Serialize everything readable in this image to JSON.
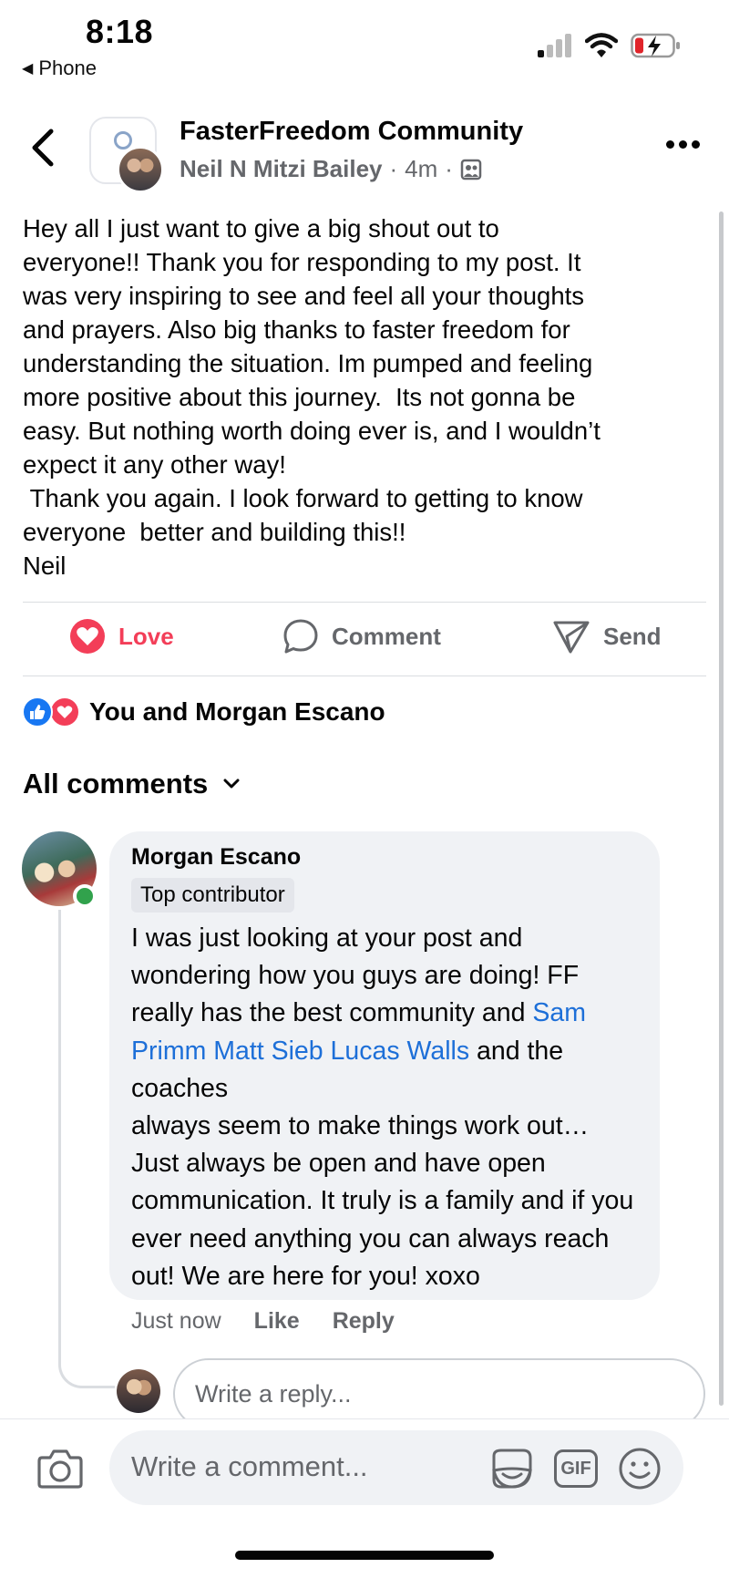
{
  "status_bar": {
    "time": "8:18",
    "back_app": "Phone",
    "icons": [
      "signal-icon",
      "wifi-icon",
      "battery-charging-icon"
    ]
  },
  "header": {
    "group_name": "FasterFreedom Community",
    "author": "Neil N Mitzi Bailey",
    "time_ago": "4m",
    "separator": "·",
    "audience_icon": "members-icon"
  },
  "post": {
    "text": "Hey all I just want to give a big shout out to\neveryone!! Thank you for responding to my post. It\nwas very inspiring to see and feel all your thoughts\nand prayers. Also big thanks to faster freedom for\nunderstanding the situation. Im pumped and feeling\nmore positive about this journey.  Its not gonna be\neasy. But nothing worth doing ever is, and I wouldn’t\nexpect it any other way!\n Thank you again. I look forward to getting to know\neveryone  better and building this!!\nNeil"
  },
  "actions": {
    "love_label": "Love",
    "comment_label": "Comment",
    "send_label": "Send"
  },
  "reactions": {
    "summary": "You and Morgan Escano",
    "types": [
      "like",
      "love"
    ]
  },
  "comments_header": {
    "label": "All comments"
  },
  "comment": {
    "author": "Morgan Escano",
    "badge": "Top contributor",
    "text_before": "I was just looking at your post and wondering how you guys are doing! FF really has the best community and ",
    "mentions": "Sam Primm Matt Sieb Lucas Walls",
    "text_after": " and the coaches\nalways seem to make things work out… Just always be open and have open communication. It truly is a family and if you ever need anything you can always reach out! We are here for you! xoxo",
    "time": "Just now",
    "like_label": "Like",
    "reply_label": "Reply"
  },
  "reply_box": {
    "placeholder": "Write a reply..."
  },
  "composer": {
    "placeholder": "Write a comment...",
    "gif_label": "GIF"
  },
  "colors": {
    "love": "#f33e58",
    "like": "#1877f2",
    "mention": "#1d6fd8",
    "secondary_text": "#65676b",
    "bubble": "#f0f2f5"
  }
}
